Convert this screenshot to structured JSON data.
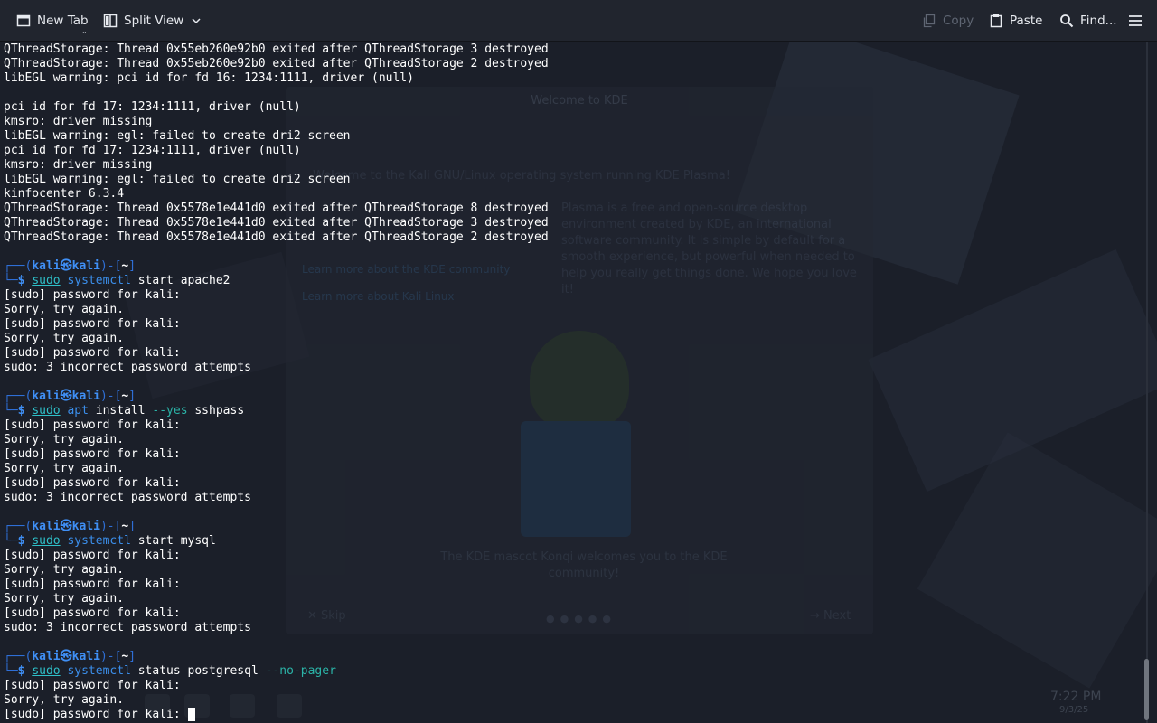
{
  "toolbar": {
    "new_tab": "New Tab",
    "split_view": "Split View",
    "copy": "Copy",
    "paste": "Paste",
    "find": "Find..."
  },
  "background": {
    "welcome_title": "Welcome to KDE",
    "welcome_line1": "Welcome to the Kali GNU/Linux operating system running KDE Plasma!",
    "welcome_line2": "Plasma is a free and open-source desktop environment created by KDE, an international software community. It is simple by default for a smooth experience, but powerful when needed to help you really get things done. We hope you love it!",
    "link1": "Learn more about the KDE community",
    "link2": "Learn more about Kali Linux",
    "caption": "The KDE mascot Konqi welcomes you to the KDE community!",
    "skip": "✕ Skip",
    "next": "→ Next",
    "clock": "7:22 PM",
    "date": "9/3/25"
  },
  "terminal": {
    "lines": [
      {
        "t": "QThreadStorage: Thread 0x55eb260e92b0 exited after QThreadStorage 3 destroyed"
      },
      {
        "t": "QThreadStorage: Thread 0x55eb260e92b0 exited after QThreadStorage 2 destroyed"
      },
      {
        "t": "libEGL warning: pci id for fd 16: 1234:1111, driver (null)"
      },
      {
        "t": ""
      },
      {
        "t": "pci id for fd 17: 1234:1111, driver (null)"
      },
      {
        "t": "kmsro: driver missing"
      },
      {
        "t": "libEGL warning: egl: failed to create dri2 screen"
      },
      {
        "t": "pci id for fd 17: 1234:1111, driver (null)"
      },
      {
        "t": "kmsro: driver missing"
      },
      {
        "t": "libEGL warning: egl: failed to create dri2 screen"
      },
      {
        "t": "kinfocenter 6.3.4"
      },
      {
        "t": "QThreadStorage: Thread 0x5578e1e441d0 exited after QThreadStorage 8 destroyed"
      },
      {
        "t": "QThreadStorage: Thread 0x5578e1e441d0 exited after QThreadStorage 3 destroyed"
      },
      {
        "t": "QThreadStorage: Thread 0x5578e1e441d0 exited after QThreadStorage 2 destroyed"
      },
      {
        "t": ""
      },
      {
        "prompt": true,
        "user": "kali㉿kali",
        "path": "~"
      },
      {
        "cmd": true,
        "sudo": "sudo",
        "name": "systemctl",
        "args": [
          {
            "k": "arg",
            "v": "start apache2"
          }
        ]
      },
      {
        "t": "[sudo] password for kali:"
      },
      {
        "t": "Sorry, try again."
      },
      {
        "t": "[sudo] password for kali:"
      },
      {
        "t": "Sorry, try again."
      },
      {
        "t": "[sudo] password for kali:"
      },
      {
        "t": "sudo: 3 incorrect password attempts"
      },
      {
        "t": ""
      },
      {
        "prompt": true,
        "user": "kali㉿kali",
        "path": "~"
      },
      {
        "cmd": true,
        "sudo": "sudo",
        "name": "apt",
        "args": [
          {
            "k": "arg",
            "v": "install"
          },
          {
            "k": "flag",
            "v": "--yes"
          },
          {
            "k": "arg",
            "v": "sshpass"
          }
        ]
      },
      {
        "t": "[sudo] password for kali:"
      },
      {
        "t": "Sorry, try again."
      },
      {
        "t": "[sudo] password for kali:"
      },
      {
        "t": "Sorry, try again."
      },
      {
        "t": "[sudo] password for kali:"
      },
      {
        "t": "sudo: 3 incorrect password attempts"
      },
      {
        "t": ""
      },
      {
        "prompt": true,
        "user": "kali㉿kali",
        "path": "~"
      },
      {
        "cmd": true,
        "sudo": "sudo",
        "name": "systemctl",
        "args": [
          {
            "k": "arg",
            "v": "start mysql"
          }
        ]
      },
      {
        "t": "[sudo] password for kali:"
      },
      {
        "t": "Sorry, try again."
      },
      {
        "t": "[sudo] password for kali:"
      },
      {
        "t": "Sorry, try again."
      },
      {
        "t": "[sudo] password for kali:"
      },
      {
        "t": "sudo: 3 incorrect password attempts"
      },
      {
        "t": ""
      },
      {
        "prompt": true,
        "user": "kali㉿kali",
        "path": "~"
      },
      {
        "cmd": true,
        "sudo": "sudo",
        "name": "systemctl",
        "args": [
          {
            "k": "arg",
            "v": "status postgresql"
          },
          {
            "k": "flag",
            "v": "--no-pager"
          }
        ]
      },
      {
        "t": "[sudo] password for kali:"
      },
      {
        "t": "Sorry, try again."
      },
      {
        "t": "[sudo] password for kali: ",
        "cursor": true
      }
    ]
  }
}
